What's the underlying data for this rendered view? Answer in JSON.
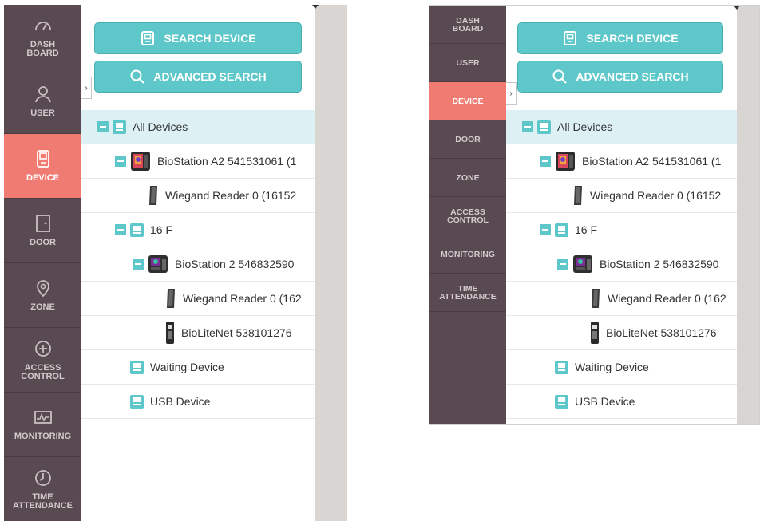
{
  "sidebar_full": [
    {
      "label": "DASH\nBOARD",
      "icon": "gauge-icon",
      "active": false
    },
    {
      "label": "USER",
      "icon": "user-icon",
      "active": false
    },
    {
      "label": "DEVICE",
      "icon": "device-icon",
      "active": true
    },
    {
      "label": "DOOR",
      "icon": "door-icon",
      "active": false
    },
    {
      "label": "ZONE",
      "icon": "location-pin-icon",
      "active": false
    },
    {
      "label": "ACCESS\nCONTROL",
      "icon": "plus-shield-icon",
      "active": false
    },
    {
      "label": "MONITORING",
      "icon": "pulse-monitor-icon",
      "active": false
    },
    {
      "label": "TIME\nATTENDANCE",
      "icon": "clock-icon",
      "active": false
    }
  ],
  "sidebar_compact": [
    {
      "label": "DASH\nBOARD",
      "active": false
    },
    {
      "label": "USER",
      "active": false
    },
    {
      "label": "DEVICE",
      "active": true
    },
    {
      "label": "DOOR",
      "active": false
    },
    {
      "label": "ZONE",
      "active": false
    },
    {
      "label": "ACCESS\nCONTROL",
      "active": false
    },
    {
      "label": "MONITORING",
      "active": false
    },
    {
      "label": "TIME\nATTENDANCE",
      "active": false
    }
  ],
  "buttons": {
    "search_device": "SEARCH DEVICE",
    "advanced_search": "ADVANCED SEARCH"
  },
  "toggle_glyph": "›",
  "tree": [
    {
      "label": "All Devices",
      "depth": 0,
      "expander": true,
      "icon": "group-icon",
      "selected": true
    },
    {
      "label": "BioStation A2 541531061 (1",
      "depth": 1,
      "expander": true,
      "icon": "biostation-a2-icon",
      "selected": false
    },
    {
      "label": "Wiegand Reader 0 (16152",
      "depth": 2,
      "expander": false,
      "icon": "reader-icon",
      "selected": false
    },
    {
      "label": "16 F",
      "depth": 1,
      "expander": true,
      "icon": "group-icon",
      "selected": false
    },
    {
      "label": "BioStation 2 546832590",
      "depth": 2,
      "expander": true,
      "icon": "biostation2-icon",
      "selected": false
    },
    {
      "label": "Wiegand Reader 0 (162",
      "depth": 3,
      "expander": false,
      "icon": "reader-icon",
      "selected": false
    },
    {
      "label": "BioLiteNet 538101276",
      "depth": 3,
      "expander": false,
      "icon": "biolite-icon",
      "selected": false
    },
    {
      "label": "Waiting Device",
      "depth": 1,
      "expander": false,
      "icon": "group-icon",
      "selected": false
    },
    {
      "label": "USB Device",
      "depth": 1,
      "expander": false,
      "icon": "group-icon",
      "selected": false
    }
  ],
  "colors": {
    "sidebar": "#594950",
    "active": "#ef7b72",
    "accent": "#5ec7c9",
    "selected_row": "#ddf1f5",
    "gutter": "#d9d5d3"
  }
}
